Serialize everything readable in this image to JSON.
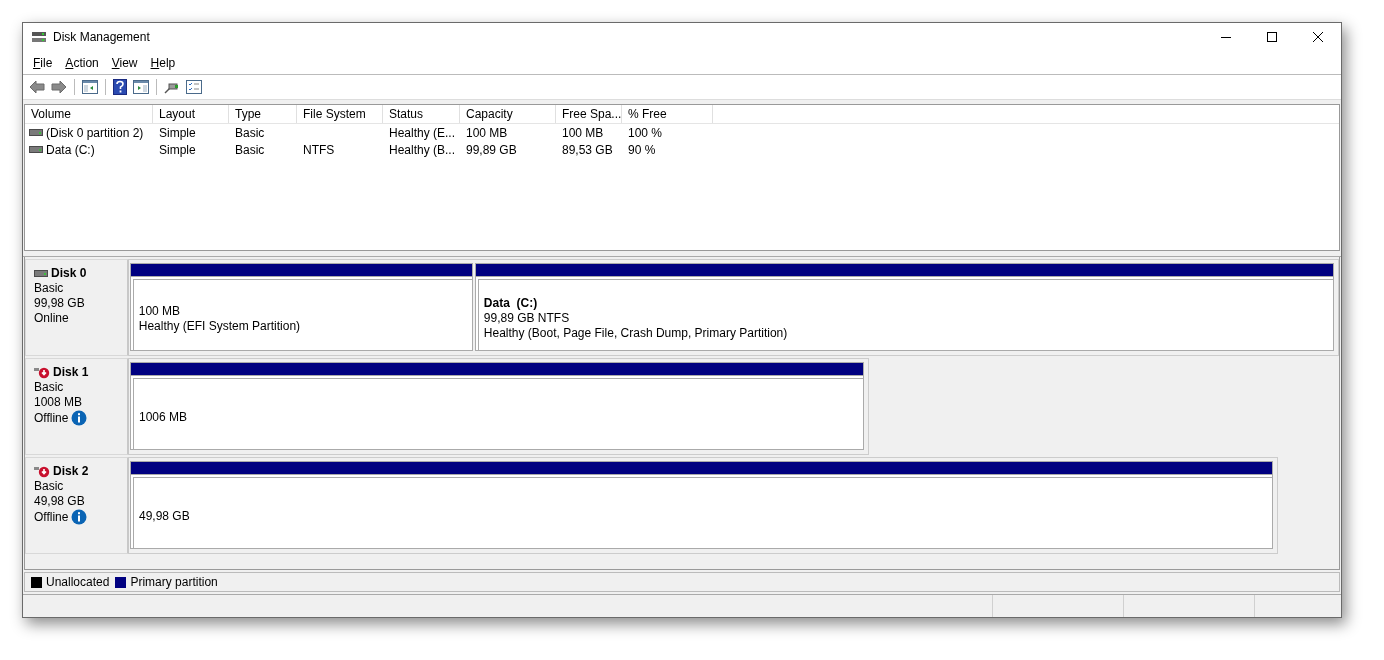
{
  "window": {
    "title": "Disk Management"
  },
  "menu": [
    "File",
    "Action",
    "View",
    "Help"
  ],
  "toolbar": [
    {
      "kind": "back"
    },
    {
      "kind": "forward"
    },
    {
      "kind": "sep"
    },
    {
      "kind": "tree"
    },
    {
      "kind": "sep"
    },
    {
      "kind": "help"
    },
    {
      "kind": "pane"
    },
    {
      "kind": "sep"
    },
    {
      "kind": "connect"
    },
    {
      "kind": "props"
    }
  ],
  "volumes": {
    "columns": [
      "Volume",
      "Layout",
      "Type",
      "File System",
      "Status",
      "Capacity",
      "Free Spa...",
      "% Free"
    ],
    "rows": [
      [
        "(Disk 0 partition 2)",
        "Simple",
        "Basic",
        "",
        "Healthy (E...",
        "100 MB",
        "100 MB",
        "100 %"
      ],
      [
        "Data (C:)",
        "Simple",
        "Basic",
        "NTFS",
        "Healthy (B...",
        "99,89 GB",
        "89,53 GB",
        "90 %"
      ]
    ]
  },
  "disks": [
    {
      "name": "Disk 0",
      "type": "Basic",
      "size": "99,98 GB",
      "status": "Online",
      "offline": false,
      "partitions": [
        {
          "kind": "primary",
          "lines": [
            "100 MB",
            "Healthy (EFI System Partition)"
          ]
        },
        {
          "kind": "primary",
          "title": "Data  (C:)",
          "lines": [
            "99,89 GB NTFS",
            "Healthy (Boot, Page File, Crash Dump, Primary Partition)"
          ]
        }
      ]
    },
    {
      "name": "Disk 1",
      "type": "Basic",
      "size": "1008 MB",
      "status": "Offline",
      "offline": true,
      "partitions": [
        {
          "kind": "primary",
          "lines": [
            "1006 MB"
          ]
        }
      ]
    },
    {
      "name": "Disk 2",
      "type": "Basic",
      "size": "49,98 GB",
      "status": "Offline",
      "offline": true,
      "partitions": [
        {
          "kind": "primary",
          "lines": [
            "49,98 GB"
          ]
        }
      ]
    }
  ],
  "legend": [
    {
      "label": "Unallocated",
      "color": "#000000"
    },
    {
      "label": "Primary partition",
      "color": "#000080"
    }
  ]
}
